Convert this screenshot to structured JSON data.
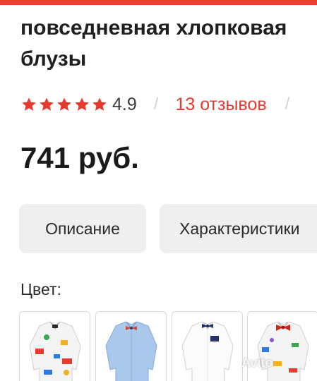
{
  "product": {
    "title_line1": "повседневная хлопковая",
    "title_line2": "блузы",
    "rating_value": "4.9",
    "rating_stars": 5,
    "reviews_link": "13 отзывов",
    "price": "741 руб."
  },
  "tabs": {
    "description": "Описание",
    "characteristics": "Характеристики"
  },
  "color": {
    "label": "Цвет:",
    "options": [
      "printed-shirt",
      "light-blue-shirt",
      "white-shirt",
      "printed-shirt-red-bow"
    ]
  },
  "watermark": "Avito",
  "colors": {
    "accent": "#ef3b2d",
    "star": "#e8392f",
    "tab_bg": "#efefef"
  }
}
